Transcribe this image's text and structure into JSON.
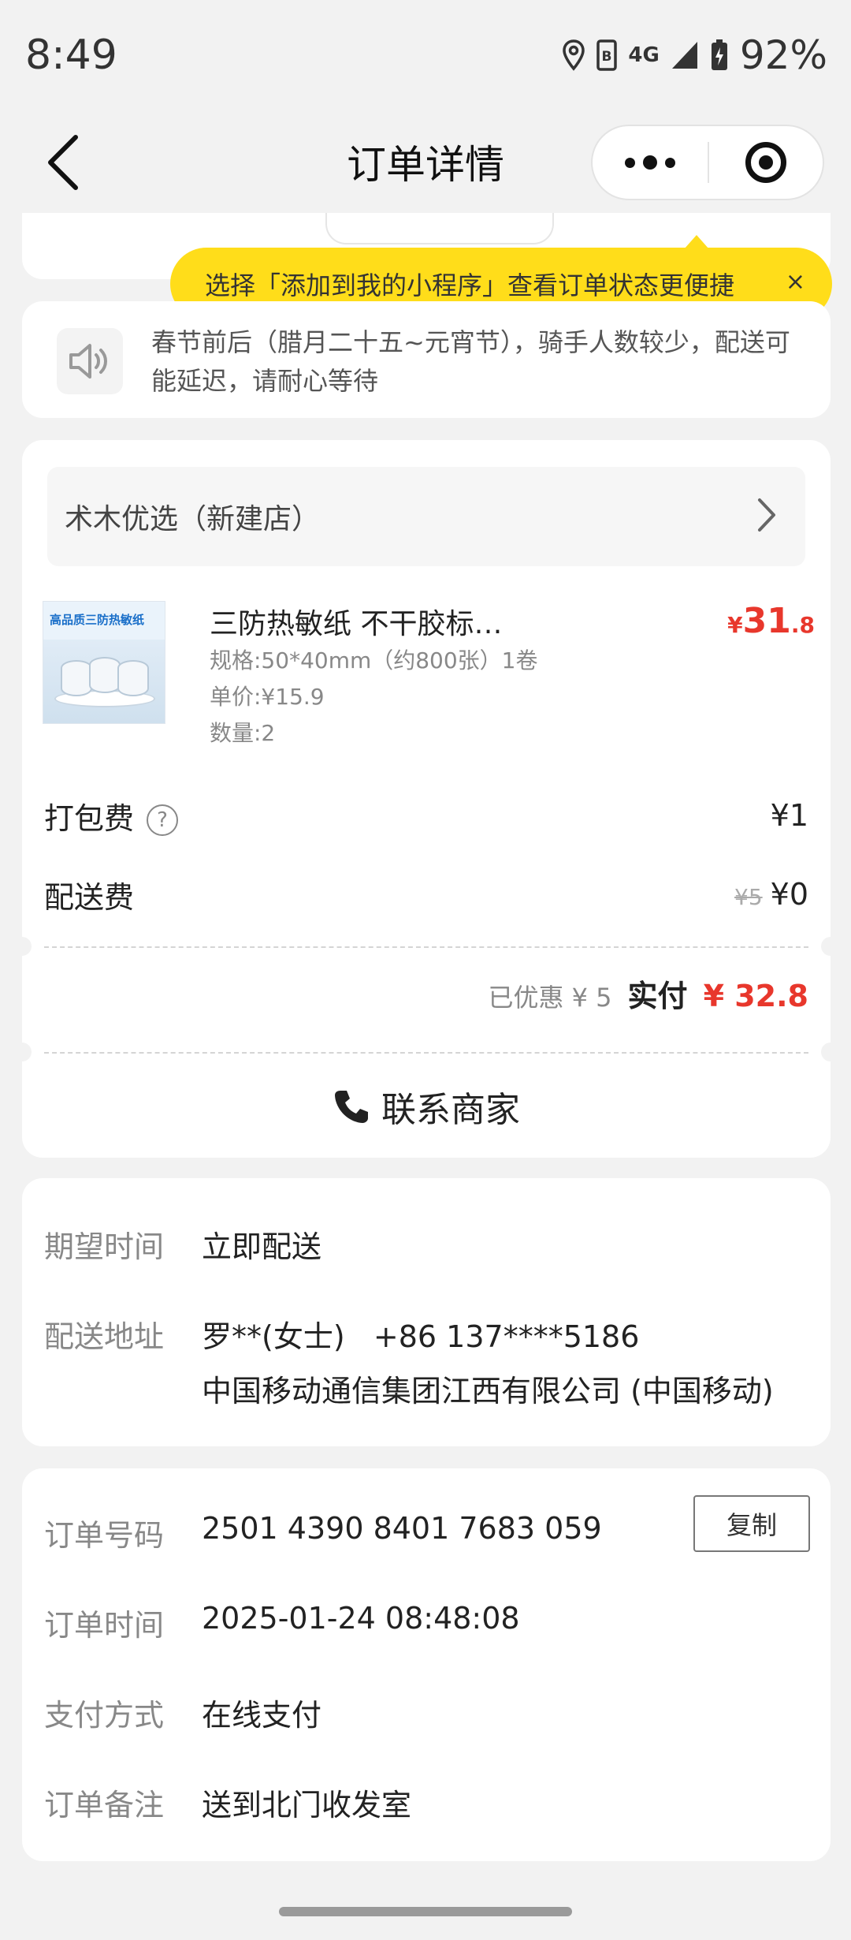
{
  "status_bar": {
    "time": "8:49",
    "network": "4G",
    "battery": "92%"
  },
  "nav": {
    "title": "订单详情"
  },
  "tooltip": {
    "text": "选择「添加到我的小程序」查看订单状态更便捷",
    "close": "×"
  },
  "notice": {
    "text": "春节前后（腊月二十五~元宵节），骑手人数较少，配送可能延迟，请耐心等待"
  },
  "shop": {
    "name": "术木优选（新建店）"
  },
  "product": {
    "name": "三防热敏纸 不干胶标…",
    "price_currency": "¥",
    "price_int": "31",
    "price_dec": ".8",
    "spec": "规格:50*40mm（约800张）1卷",
    "unit_price": "单价:¥15.9",
    "quantity": "数量:2",
    "thumb_label": "高品质三防热敏纸"
  },
  "fees": {
    "packing_label": "打包费",
    "packing_help": "?",
    "packing_value": "¥1",
    "delivery_label": "配送费",
    "delivery_original": "¥5",
    "delivery_value": "¥0"
  },
  "total": {
    "saved": "已优惠 ¥ 5",
    "paid_label": "实付",
    "paid_value": "¥ 32.8"
  },
  "contact": {
    "label": "联系商家"
  },
  "delivery_info": {
    "time_label": "期望时间",
    "time_value": "立即配送",
    "address_label": "配送地址",
    "recipient": "罗**(女士)   +86 137****5186",
    "address": "中国移动通信集团江西有限公司 (中国移动)"
  },
  "order_info": {
    "number_label": "订单号码",
    "number_value": "2501 4390 8401 7683 059",
    "copy_label": "复制",
    "time_label": "订单时间",
    "time_value": "2025-01-24 08:48:08",
    "payment_label": "支付方式",
    "payment_value": "在线支付",
    "note_label": "订单备注",
    "note_value": "送到北门收发室"
  },
  "colors": {
    "accent_red": "#e8372c",
    "tooltip_yellow": "#ffdd1a",
    "background": "#f2f2f2"
  }
}
